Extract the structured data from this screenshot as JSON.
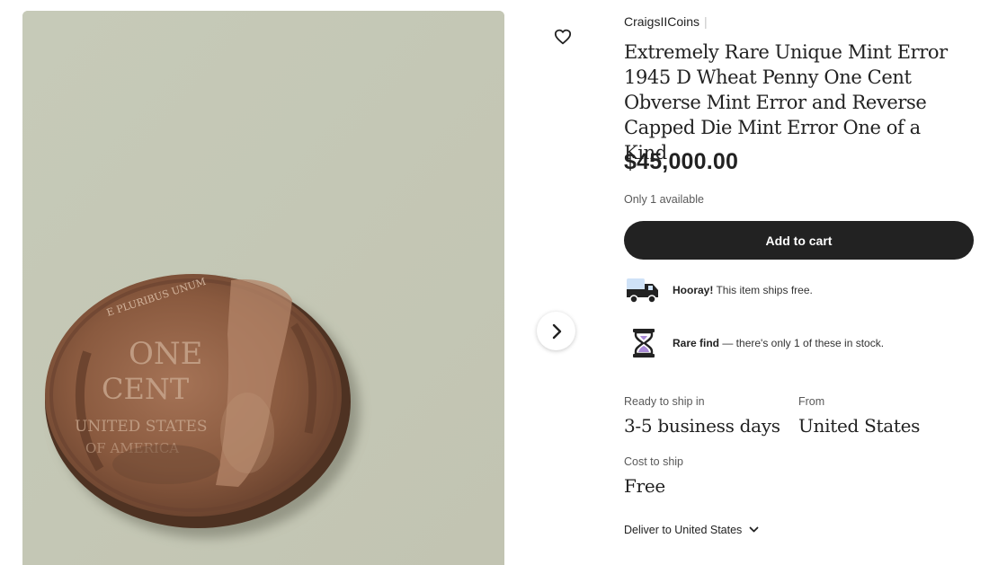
{
  "listing": {
    "shop_name": "CraigsIICoins",
    "title": "Extremely Rare Unique Mint Error 1945 D Wheat Penny One Cent Obverse Mint Error and Reverse Capped Die Mint Error One of a Kind",
    "price": "$45,000.00",
    "availability": "Only 1 available",
    "add_to_cart_label": "Add to cart"
  },
  "perks": [
    {
      "icon": "delivery-truck-icon",
      "bold": "Hooray!",
      "text": " This item ships free."
    },
    {
      "icon": "hourglass-icon",
      "bold": "Rare find",
      "text": " — there's only 1 of these in stock."
    }
  ],
  "shipping": {
    "ready_label": "Ready to ship in",
    "ready_value": "3-5 business days",
    "from_label": "From",
    "from_value": "United States",
    "cost_label": "Cost to ship",
    "cost_value": "Free",
    "deliver_to": "Deliver to United States"
  },
  "gallery": {
    "coin_text_top": "E PLURIBUS UNUM",
    "coin_text_one": "ONE",
    "coin_text_cent": "CENT",
    "coin_text_usa": "UNITED STATES",
    "coin_text_of": "OF AMERICA"
  },
  "colors": {
    "button_bg": "#222222",
    "photo_bg": "#c5c8b6",
    "coin_copper": "#8a5a3c"
  }
}
